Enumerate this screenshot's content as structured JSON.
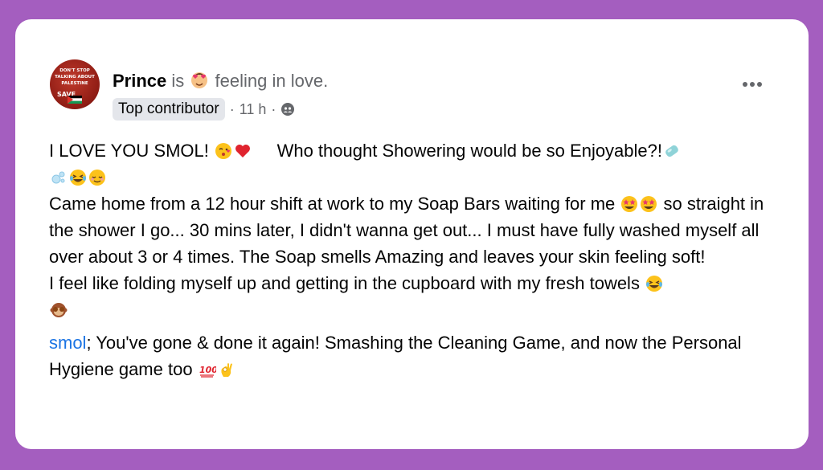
{
  "post": {
    "author": "Prince",
    "is_text": "is",
    "feeling": "feeling in love.",
    "badge": "Top contributor",
    "sep1": "·",
    "time": "11 h",
    "sep2": "·",
    "avatar_text": [
      "DON'T STOP",
      "TALKING ABOUT",
      "PALESTINE",
      "SAVE"
    ],
    "line1": "I LOVE YOU SMOL!",
    "line1b": "Who thought Showering would be so Enjoyable?!",
    "para1": "Came home from a 12 hour shift at work to my Soap Bars waiting for me",
    "para1b": "so straight in the shower I go... 30 mins later, I didn't wanna get out... I must have fully washed myself all over about 3 or 4 times. The Soap smells Amazing and leaves your skin feeling soft!",
    "para2": "I feel like folding myself up and getting in the cupboard with my fresh towels",
    "mention": "smol",
    "para3": "; You've gone & done it again!  Smashing the Cleaning Game, and now the Personal Hygiene game too",
    "icons": {
      "feeling": "heart-eyes-emoji-icon",
      "audience": "friends-icon",
      "more": "more-options-icon"
    },
    "colors": {
      "background": "#a45ebf",
      "mention": "#1b74e4",
      "badge_bg": "#e4e6eb"
    }
  }
}
